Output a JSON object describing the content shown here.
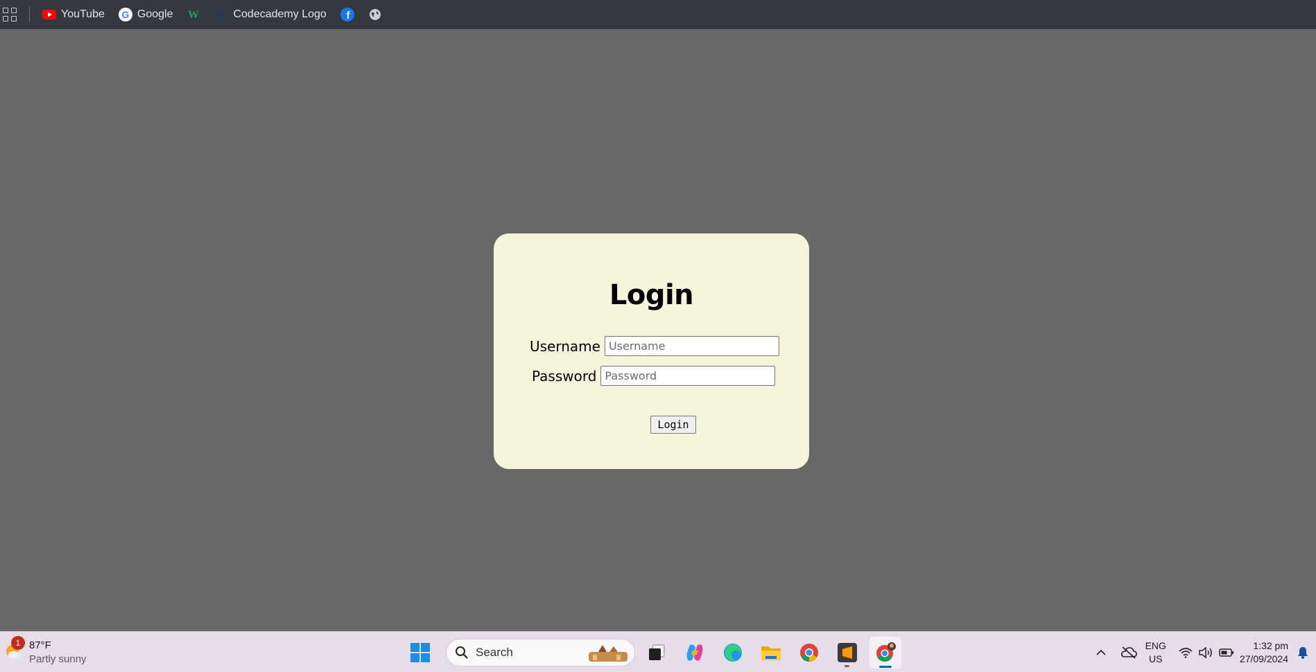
{
  "bookmarks": [
    {
      "label": "YouTube",
      "icon": "youtube-icon"
    },
    {
      "label": "Google",
      "icon": "google-icon"
    },
    {
      "label": "",
      "icon": "w-logo-icon"
    },
    {
      "label": "Codecademy Logo",
      "icon": "codecademy-icon"
    },
    {
      "label": "",
      "icon": "facebook-icon"
    },
    {
      "label": "",
      "icon": "globe-icon"
    }
  ],
  "login": {
    "title": "Login",
    "username_label": "Username",
    "username_placeholder": "Username",
    "password_label": "Password",
    "password_placeholder": "Password",
    "button_label": "Login"
  },
  "taskbar": {
    "weather": {
      "temp": "87°F",
      "condition": "Partly sunny",
      "badge": "1"
    },
    "search_placeholder": "Search",
    "language": {
      "line1": "ENG",
      "line2": "US"
    },
    "time": "1:32 pm",
    "date": "27/09/2024"
  },
  "colors": {
    "page_bg": "#686868",
    "bookmarks_bar": "#353840",
    "card_bg": "#f5f5dc",
    "taskbar_bg": "#e7dce9",
    "accent": "#0067c0"
  }
}
